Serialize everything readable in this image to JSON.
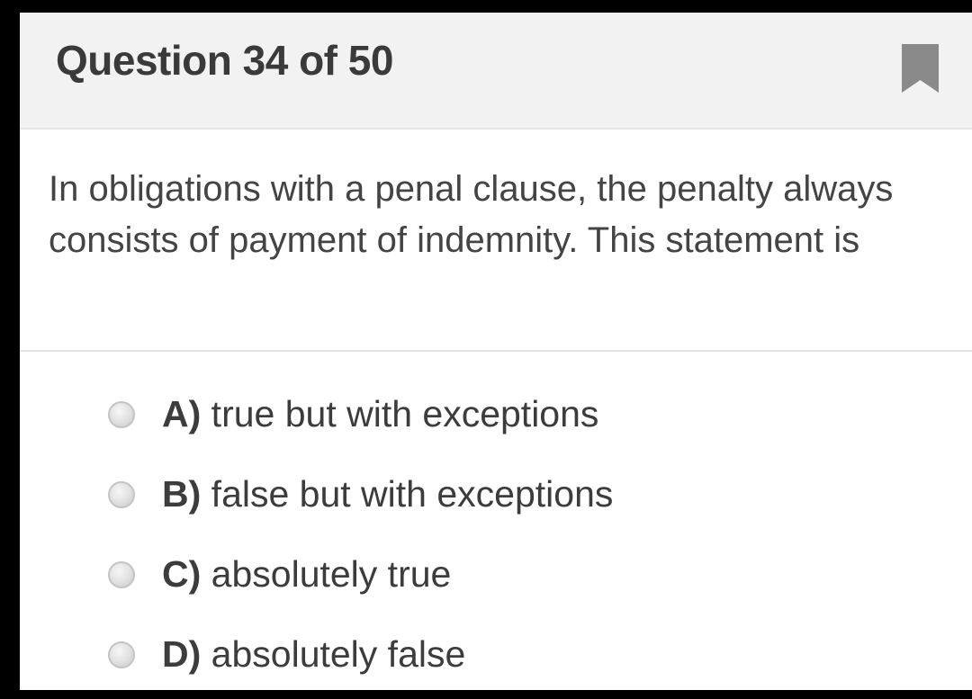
{
  "header": {
    "title": "Question 34 of 50",
    "bookmark_icon": "bookmark-icon"
  },
  "question": {
    "text": "In obligations with a penal clause, the penalty always consists of payment of indemnity. This statement is"
  },
  "options": [
    {
      "letter": "A)",
      "text": "true but with exceptions",
      "selected": false
    },
    {
      "letter": "B)",
      "text": "false but with exceptions",
      "selected": false
    },
    {
      "letter": "C)",
      "text": "absolutely true",
      "selected": false
    },
    {
      "letter": "D)",
      "text": "absolutely false",
      "selected": false
    }
  ],
  "colors": {
    "background": "#000000",
    "card": "#ffffff",
    "header": "#f2f2f2",
    "title": "#3a3a3a",
    "text": "#444444",
    "bookmark": "#8a8a8a"
  }
}
